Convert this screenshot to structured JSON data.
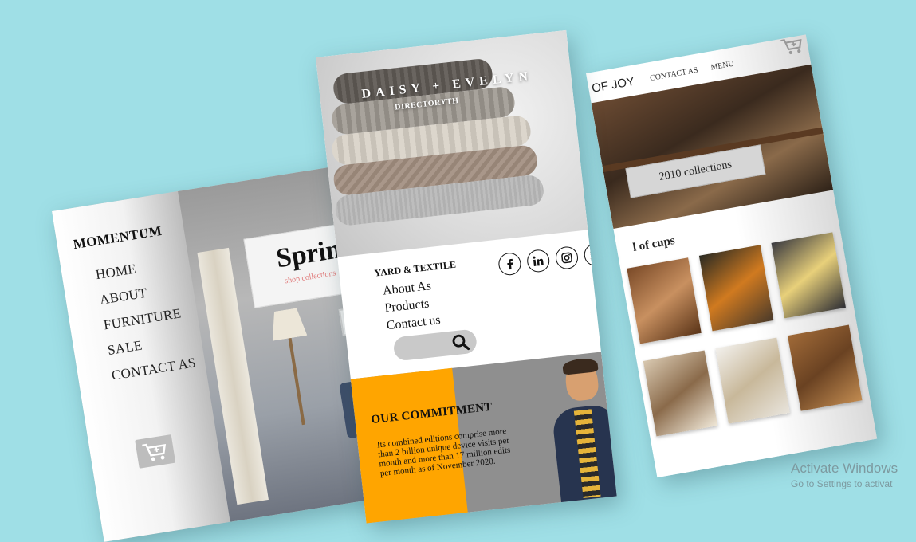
{
  "left_card": {
    "brand": "MOMENTUM",
    "nav": [
      "HOME",
      "ABOUT",
      "FURNITURE",
      "SALE",
      "CONTACT AS"
    ],
    "banner_title": "Spring co",
    "banner_link": "shop collections"
  },
  "right_card": {
    "brand": "OF JOY",
    "links": [
      "CONTACT AS",
      "MENU"
    ],
    "hero_button": "2010 collections",
    "section_title": "l of cups"
  },
  "center_card": {
    "hero_title": "DAISY + EVELYN",
    "hero_subtitle": "DIRECTORYTH",
    "yard_title": "YARD & TEXTILE",
    "links": [
      "About As",
      "Products",
      "Contact us"
    ],
    "social_icons": [
      "facebook-icon",
      "linkedin-icon",
      "instagram-icon",
      "twitter-icon"
    ],
    "commitment_title": "OUR COMMITMENT",
    "commitment_text": "Its combined editions comprise more than 2 billion unique device visits per month and more than 17 million edits per month as of November 2020."
  },
  "watermark": {
    "title": "Activate Windows",
    "subtitle": "Go to Settings to activat"
  },
  "colors": {
    "background": "#9fdfe6",
    "orange": "#ffa500",
    "accent_pink": "#e07a7a"
  }
}
